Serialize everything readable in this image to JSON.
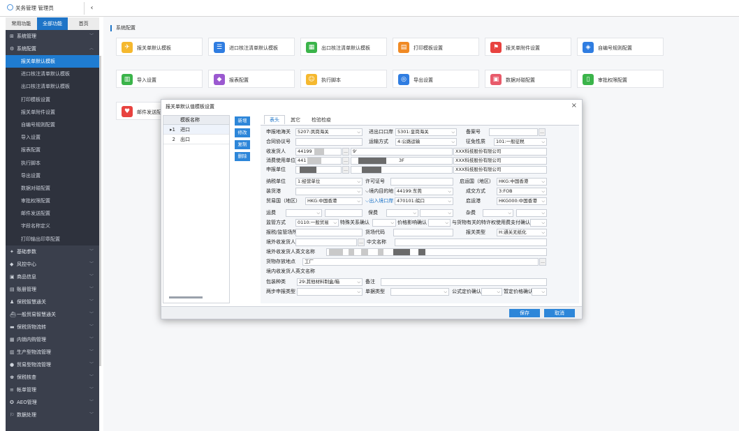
{
  "app": {
    "title": "关务管理 管理员",
    "collapse_icon": "chevron-left"
  },
  "sidebar": {
    "tabs": [
      "常用功能",
      "全部功能",
      "首页"
    ],
    "menu": [
      {
        "label": "系统管理",
        "icon": "grid"
      },
      {
        "label": "系统配置",
        "icon": "gear",
        "expanded": true,
        "children": [
          {
            "label": "报关单默认模板",
            "active": true
          },
          {
            "label": "进口核注清单默认模板"
          },
          {
            "label": "出口核注清单默认模板"
          },
          {
            "label": "打印模板设置"
          },
          {
            "label": "报关单附件设置"
          },
          {
            "label": "自编号规则配置"
          },
          {
            "label": "导入设置"
          },
          {
            "label": "报表配置"
          },
          {
            "label": "执行脚本"
          },
          {
            "label": "导出设置"
          },
          {
            "label": "数据对碰配置"
          },
          {
            "label": "审批权限配置"
          },
          {
            "label": "邮件发送配置"
          },
          {
            "label": "字段名称定义"
          },
          {
            "label": "打印输出印章配置"
          }
        ]
      },
      {
        "label": "基础参数",
        "icon": "pin"
      },
      {
        "label": "风控中心",
        "icon": "shield"
      },
      {
        "label": "商品信息",
        "icon": "box"
      },
      {
        "label": "账册管理",
        "icon": "book"
      },
      {
        "label": "保税智慧通关",
        "icon": "user"
      },
      {
        "label": "一般贸易智慧通关",
        "icon": "ship"
      },
      {
        "label": "保税货物流转",
        "icon": "truck"
      },
      {
        "label": "内销内购管理",
        "icon": "cart"
      },
      {
        "label": "生产型物流管理",
        "icon": "factory"
      },
      {
        "label": "贸易型物流管理",
        "icon": "globe"
      },
      {
        "label": "保税核查",
        "icon": "check"
      },
      {
        "label": "帐单管理",
        "icon": "bill"
      },
      {
        "label": "AEO管理",
        "icon": "award"
      },
      {
        "label": "数据处理",
        "icon": "data"
      }
    ]
  },
  "main": {
    "breadcrumb": "系统配置",
    "tiles": [
      {
        "label": "报关单默认模板",
        "color": "#f5b82e",
        "icon": "plane"
      },
      {
        "label": "进口核注清单默认模板",
        "color": "#2f7de1",
        "icon": "list"
      },
      {
        "label": "出口核注清单默认模板",
        "color": "#3bb44a",
        "icon": "grid"
      },
      {
        "label": "打印模板设置",
        "color": "#f08a24",
        "icon": "printer"
      },
      {
        "label": "报关单附件设置",
        "color": "#e8423f",
        "icon": "flag"
      },
      {
        "label": "自编号规则配置",
        "color": "#2f7de1",
        "icon": "layers"
      },
      {
        "label": "导入设置",
        "color": "#3bb44a",
        "icon": "document"
      },
      {
        "label": "报表配置",
        "color": "#9b59d0",
        "icon": "tag"
      },
      {
        "label": "执行脚本",
        "color": "#f5b82e",
        "icon": "robot"
      },
      {
        "label": "导出设置",
        "color": "#2f7de1",
        "icon": "compass"
      },
      {
        "label": "数据对碰配置",
        "color": "#e85a6a",
        "icon": "cube"
      },
      {
        "label": "审批权限配置",
        "color": "#3bb44a",
        "icon": "clipboard"
      },
      {
        "label": "邮件发送配置",
        "color": "#e8423f",
        "icon": "heart"
      }
    ]
  },
  "modal": {
    "title": "报关单默认值模板设置",
    "close": "×",
    "table": {
      "header": "模板名称",
      "rows": [
        {
          "num": "1",
          "name": "进口",
          "selected": true
        },
        {
          "num": "2",
          "name": "出口"
        }
      ]
    },
    "buttons": {
      "add": "新增",
      "edit": "修改",
      "copy": "复制",
      "delete": "删除"
    },
    "tabs": [
      "表头",
      "其它",
      "检验检疫"
    ],
    "labels": {
      "customs_port": "申报地海关",
      "exit_port": "进出口口岸",
      "record_no": "备案号",
      "contract_no": "合同协议号",
      "transport_mode": "运输方式",
      "tax_nature": "征免性质",
      "consignee": "收发货人",
      "consumer": "消费使用单位",
      "declarant": "申报单位",
      "tax_unit": "纳税单位",
      "license_no": "许可证号",
      "origin_country": "启运国（地区）",
      "port_of_loading": "装货港",
      "domestic_dest": "境内目的地",
      "deal_mode": "成交方式",
      "trade_country": "贸易国（地区）",
      "entry_exit_port": "出入境口岸",
      "origin_port": "启运港",
      "freight": "运费",
      "insurance": "保费",
      "misc_fee": "杂费",
      "supervision": "监管方式",
      "special_relation": "特殊关系确认",
      "price_effect": "价格影响确认",
      "royalty": "与货物有关的特许权使用费支付确认",
      "bonded_place": "报税/监管场所",
      "goods_place_code": "货场代码",
      "report_type": "报关类型",
      "overseas_consignee": "境外收发货人",
      "cn_name": "中文名称",
      "overseas_en_name": "境外收发货人英文名称",
      "storage_place": "货物存放地点",
      "domestic_en_name": "境内收发货人英文名称",
      "package_type": "包装种类",
      "remarks": "备注",
      "two_step": "两步申报类型",
      "doc_type": "单据类型",
      "formula_price": "公式定价确认",
      "provisional_price": "暂定价格确认"
    },
    "values": {
      "customs_port": "5207:凤岗海关",
      "exit_port": "5301:皇岗海关",
      "tax_nature": "101:一般征税",
      "transport_mode": "4:公路运输",
      "consignee_code": "44199",
      "consignee_code2": "9'",
      "consignee_name": "XXX科技股份有限公司",
      "consumer_code": "441",
      "consumer_suffix": "3F",
      "consumer_name": "XXX科技股份有限公司",
      "declarant_name": "XXX科技股份有限公司",
      "tax_unit": "1:经营单位",
      "origin_country": "HKG:中国香港",
      "domestic_dest": "44199:东莞",
      "deal_mode": "3:FOB",
      "trade_country": "HKG:中国香港",
      "entry_exit_port": "470101:皖口",
      "origin_port": "HKG000:中国香港",
      "supervision": "0110:一般贸易",
      "report_type": "H:通关无纸化",
      "storage_place": "工厂",
      "package_type": "29:其他材料制盒/箱"
    },
    "footer": {
      "save": "保存",
      "cancel": "取消"
    }
  }
}
